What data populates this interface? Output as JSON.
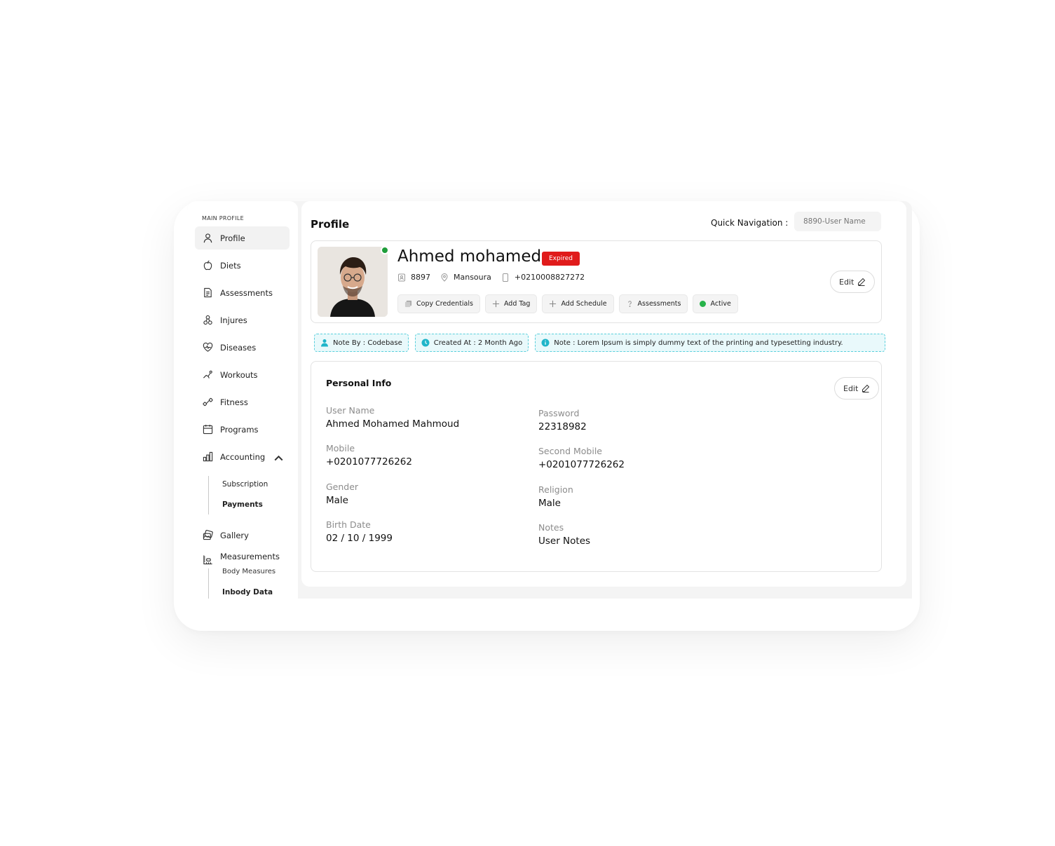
{
  "sidebar": {
    "section_title": "MAIN PROFILE",
    "items": [
      {
        "label": "Profile"
      },
      {
        "label": "Diets"
      },
      {
        "label": "Assessments"
      },
      {
        "label": "Injures"
      },
      {
        "label": "Diseases"
      },
      {
        "label": "Workouts"
      },
      {
        "label": "Fitness"
      },
      {
        "label": "Programs"
      },
      {
        "label": "Accounting"
      },
      {
        "label": "Gallery"
      },
      {
        "label": "Measurements"
      }
    ],
    "accounting_sub": [
      "Subscription",
      "Payments"
    ],
    "measurements_sub": [
      "Body Measures",
      "Inbody Data"
    ]
  },
  "header": {
    "title": "Profile",
    "quick_nav_label": "Quick Navigation :",
    "quick_nav_placeholder": "8890-User Name"
  },
  "profile": {
    "name": "Ahmed mohamed",
    "status_badge": "Expired",
    "id": "8897",
    "city": "Mansoura",
    "phone": "+0210008827272",
    "actions": [
      "Copy Credentials",
      "Add Tag",
      "Add Schedule",
      "Assessments",
      "Active"
    ],
    "edit_label": "Edit"
  },
  "notes": {
    "note_by": "Note By : Codebase",
    "created_at": "Created At : 2 Month Ago",
    "note": "Note : Lorem Ipsum is simply dummy text of the printing and typesetting industry."
  },
  "personal_info": {
    "title": "Personal Info",
    "edit_label": "Edit",
    "fields": {
      "user_name": {
        "label": "User Name",
        "value": "Ahmed Mohamed Mahmoud"
      },
      "mobile": {
        "label": "Mobile",
        "value": "+0201077726262"
      },
      "gender": {
        "label": "Gender",
        "value": "Male"
      },
      "birth_date": {
        "label": "Birth Date",
        "value": "02 / 10 / 1999"
      },
      "password": {
        "label": "Password",
        "value": "22318982"
      },
      "second_mobile": {
        "label": "Second Mobile",
        "value": "+0201077726262"
      },
      "religion": {
        "label": "Religion",
        "value": "Male"
      },
      "notes": {
        "label": "Notes",
        "value": "User Notes"
      }
    }
  },
  "colors": {
    "accent_red": "#e01b1b",
    "online_green": "#1f9d3a",
    "note_cyan": "#58cfdc",
    "note_bg": "#e9f9fb"
  }
}
